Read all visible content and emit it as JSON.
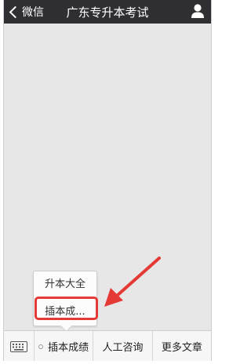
{
  "header": {
    "back_label": "微信",
    "title": "广东专升本考试"
  },
  "popup": {
    "items": [
      {
        "label": "升本大全"
      },
      {
        "label": "插本成..."
      }
    ]
  },
  "bottom_menu": {
    "tabs": [
      {
        "label": "插本成绩"
      },
      {
        "label": "人工咨询"
      },
      {
        "label": "更多文章"
      }
    ]
  },
  "colors": {
    "header_bg": "#2f2f33",
    "content_bg": "#e7e7e7",
    "annotation_red": "#e53935"
  },
  "icons": {
    "back": "chevron-left-icon",
    "user": "user-icon",
    "keyboard": "keyboard-icon",
    "submenu": "submenu-dot-icon"
  }
}
